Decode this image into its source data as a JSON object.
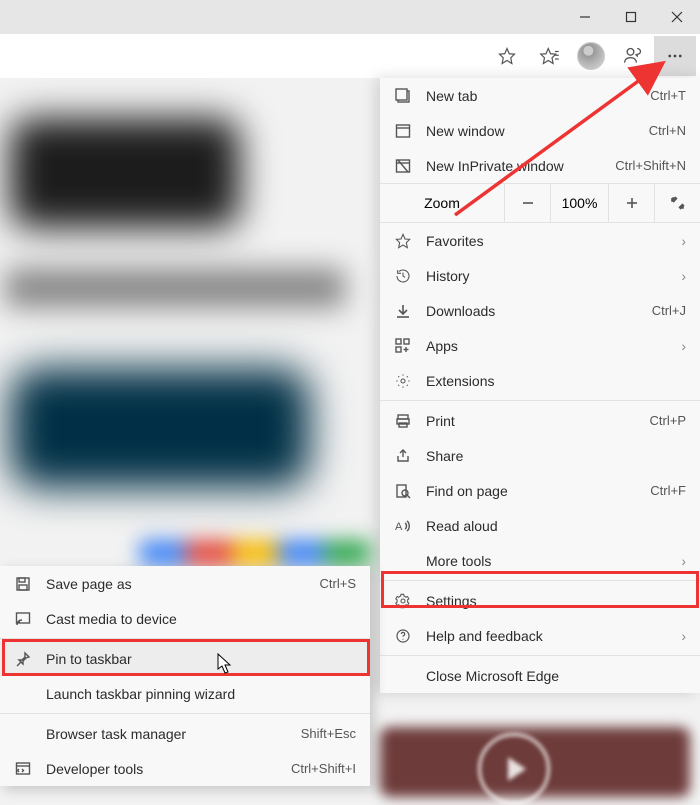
{
  "menu": {
    "newtab": {
      "label": "New tab",
      "shortcut": "Ctrl+T"
    },
    "newwin": {
      "label": "New window",
      "shortcut": "Ctrl+N"
    },
    "newinpriv": {
      "label": "New InPrivate window",
      "shortcut": "Ctrl+Shift+N"
    },
    "zoom": {
      "label": "Zoom",
      "pct": "100%"
    },
    "favorites": {
      "label": "Favorites"
    },
    "history": {
      "label": "History"
    },
    "downloads": {
      "label": "Downloads",
      "shortcut": "Ctrl+J"
    },
    "apps": {
      "label": "Apps"
    },
    "extensions": {
      "label": "Extensions"
    },
    "print": {
      "label": "Print",
      "shortcut": "Ctrl+P"
    },
    "share": {
      "label": "Share"
    },
    "find": {
      "label": "Find on page",
      "shortcut": "Ctrl+F"
    },
    "readaloud": {
      "label": "Read aloud"
    },
    "moretools": {
      "label": "More tools"
    },
    "settings": {
      "label": "Settings"
    },
    "help": {
      "label": "Help and feedback"
    },
    "close": {
      "label": "Close Microsoft Edge"
    }
  },
  "submenu": {
    "savepage": {
      "label": "Save page as",
      "shortcut": "Ctrl+S"
    },
    "cast": {
      "label": "Cast media to device"
    },
    "pin": {
      "label": "Pin to taskbar"
    },
    "launchpin": {
      "label": "Launch taskbar pinning wizard"
    },
    "taskmgr": {
      "label": "Browser task manager",
      "shortcut": "Shift+Esc"
    },
    "devtools": {
      "label": "Developer tools",
      "shortcut": "Ctrl+Shift+I"
    }
  }
}
